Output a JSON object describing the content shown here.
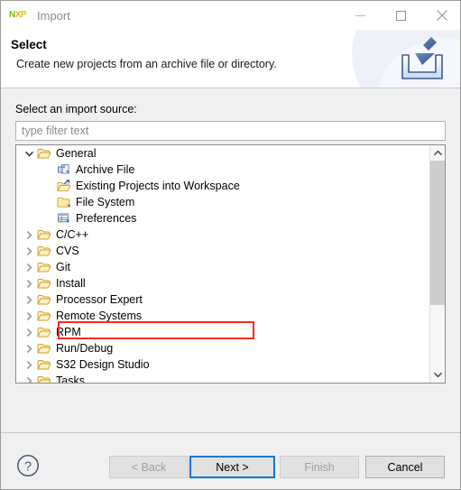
{
  "window": {
    "app_icon": "nxp-logo-icon",
    "title": "Import",
    "controls": {
      "minimize": "minimize-icon",
      "maximize": "maximize-icon",
      "close": "close-icon"
    }
  },
  "header": {
    "title": "Select",
    "description": "Create new projects from an archive file or directory.",
    "banner_icon": "import-arrow-into-tray-icon"
  },
  "main": {
    "source_label": "Select an import source:",
    "filter": {
      "value": "",
      "placeholder": "type filter text"
    },
    "tree": [
      {
        "label": "General",
        "icon": "open-folder-icon",
        "twisty": "expanded",
        "indent": 0
      },
      {
        "label": "Archive File",
        "icon": "archive-file-icon",
        "twisty": "none",
        "indent": 1
      },
      {
        "label": "Existing Projects into Workspace",
        "icon": "import-folder-icon",
        "twisty": "none",
        "indent": 1,
        "highlighted": true
      },
      {
        "label": "File System",
        "icon": "closed-folder-icon",
        "twisty": "none",
        "indent": 1
      },
      {
        "label": "Preferences",
        "icon": "preferences-grid-icon",
        "twisty": "none",
        "indent": 1
      },
      {
        "label": "C/C++",
        "icon": "open-folder-icon",
        "twisty": "collapsed",
        "indent": 0
      },
      {
        "label": "CVS",
        "icon": "open-folder-icon",
        "twisty": "collapsed",
        "indent": 0
      },
      {
        "label": "Git",
        "icon": "open-folder-icon",
        "twisty": "collapsed",
        "indent": 0
      },
      {
        "label": "Install",
        "icon": "open-folder-icon",
        "twisty": "collapsed",
        "indent": 0
      },
      {
        "label": "Processor Expert",
        "icon": "open-folder-icon",
        "twisty": "collapsed",
        "indent": 0
      },
      {
        "label": "Remote Systems",
        "icon": "open-folder-icon",
        "twisty": "collapsed",
        "indent": 0
      },
      {
        "label": "RPM",
        "icon": "open-folder-icon",
        "twisty": "collapsed",
        "indent": 0
      },
      {
        "label": "Run/Debug",
        "icon": "open-folder-icon",
        "twisty": "collapsed",
        "indent": 0
      },
      {
        "label": "S32 Design Studio",
        "icon": "open-folder-icon",
        "twisty": "collapsed",
        "indent": 0
      },
      {
        "label": "Tasks",
        "icon": "open-folder-icon",
        "twisty": "collapsed",
        "indent": 0
      }
    ],
    "scrollbar": {
      "up_arrow": "chevron-up-icon",
      "down_arrow": "chevron-down-icon"
    },
    "highlight_color": "#fc2b24"
  },
  "footer": {
    "help": "help-question-icon",
    "buttons": [
      {
        "label": "< Back",
        "enabled": false,
        "focused": false
      },
      {
        "label": "Next >",
        "enabled": true,
        "focused": true
      },
      {
        "label": "Finish",
        "enabled": false,
        "focused": false
      },
      {
        "label": "Cancel",
        "enabled": true,
        "focused": false
      }
    ],
    "focus_color": "#0078d7"
  }
}
